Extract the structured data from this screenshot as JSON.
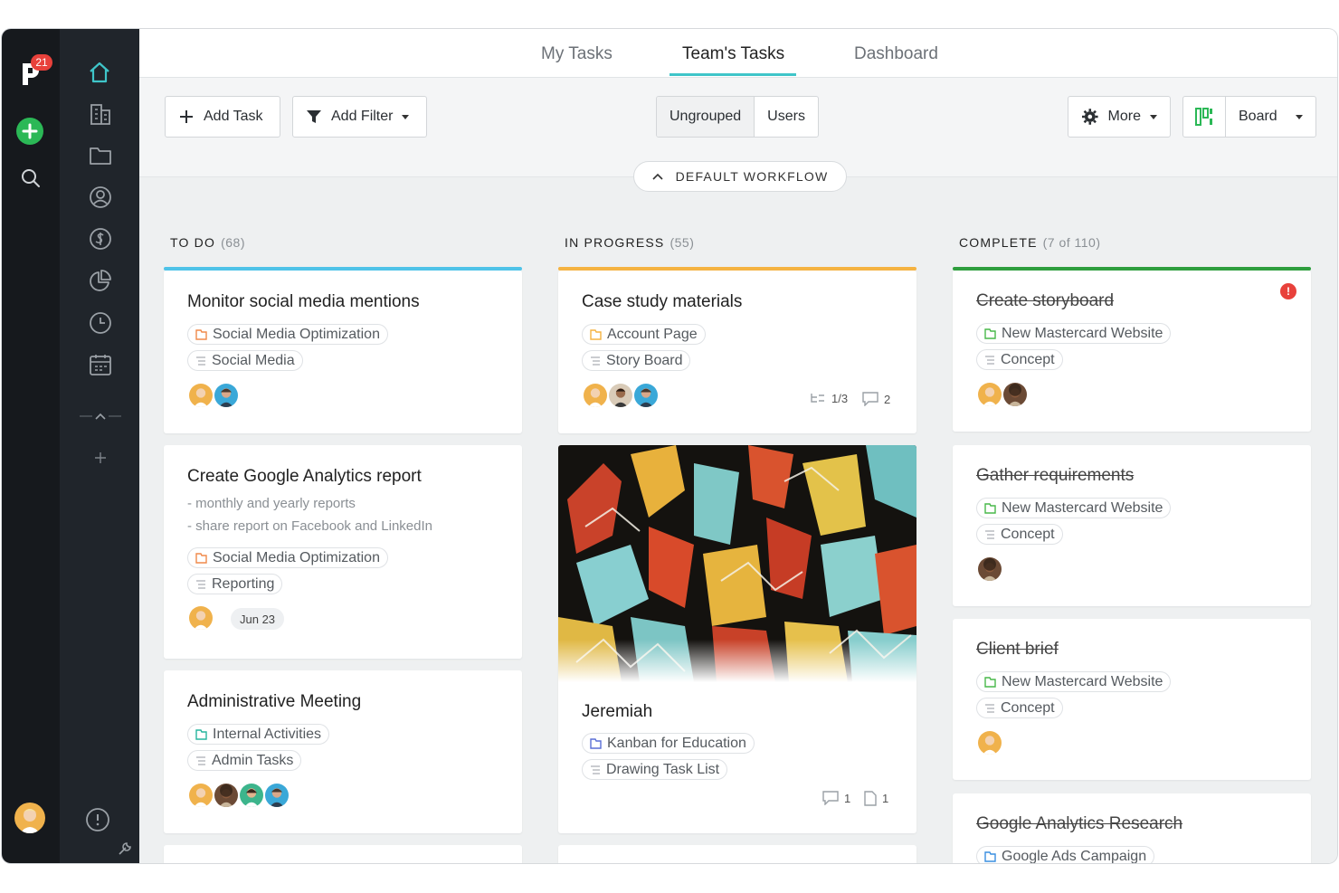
{
  "sidebar": {
    "notification_count": "21",
    "nav_icons": [
      "home-icon",
      "building-icon",
      "folder-icon",
      "person-icon",
      "dollar-icon",
      "pie-chart-icon",
      "clock-icon",
      "calendar-icon"
    ]
  },
  "header": {
    "tabs": [
      {
        "label": "My Tasks",
        "active": false
      },
      {
        "label": "Team's Tasks",
        "active": true
      },
      {
        "label": "Dashboard",
        "active": false
      }
    ]
  },
  "toolbar": {
    "add_task": "Add Task",
    "add_filter": "Add Filter",
    "group_options": [
      "Ungrouped",
      "Users"
    ],
    "group_selected": "Ungrouped",
    "more": "More",
    "view": "Board",
    "workflow": "DEFAULT WORKFLOW"
  },
  "colors": {
    "accent": "#3fc5c9",
    "todo": "#4fc3e8",
    "in_progress": "#f5b342",
    "complete": "#2e9e3e",
    "add": "#2bb856",
    "alert": "#e8413b"
  },
  "columns": [
    {
      "title": "TO DO",
      "count": "(68)",
      "cards": [
        {
          "title": "Monitor social media mentions",
          "project": "Social Media Optimization",
          "list": "Social Media"
        },
        {
          "title": "Create Google Analytics report",
          "desc": [
            "- monthly and yearly reports",
            "- share report on Facebook and LinkedIn"
          ],
          "project": "Social Media Optimization",
          "list": "Reporting",
          "date": "Jun 23"
        },
        {
          "title": "Administrative Meeting",
          "project": "Internal Activities",
          "list": "Admin Tasks"
        }
      ]
    },
    {
      "title": "IN PROGRESS",
      "count": "(55)",
      "cards": [
        {
          "title": "Case study materials",
          "project": "Account Page",
          "list": "Story Board",
          "subtasks": "1/3",
          "comments": "2"
        },
        {
          "title": "Jeremiah",
          "project": "Kanban for Education",
          "list": "Drawing Task List",
          "comments": "1",
          "files": "1"
        }
      ]
    },
    {
      "title": "COMPLETE",
      "count": "(7 of 110)",
      "cards": [
        {
          "title": "Create storyboard",
          "project": "New Mastercard Website",
          "list": "Concept",
          "alert": "!"
        },
        {
          "title": "Gather requirements",
          "project": "New Mastercard Website",
          "list": "Concept"
        },
        {
          "title": "Client brief",
          "project": "New Mastercard Website",
          "list": "Concept"
        },
        {
          "title": "Google Analytics Research",
          "project": "Google Ads Campaign"
        }
      ]
    }
  ]
}
